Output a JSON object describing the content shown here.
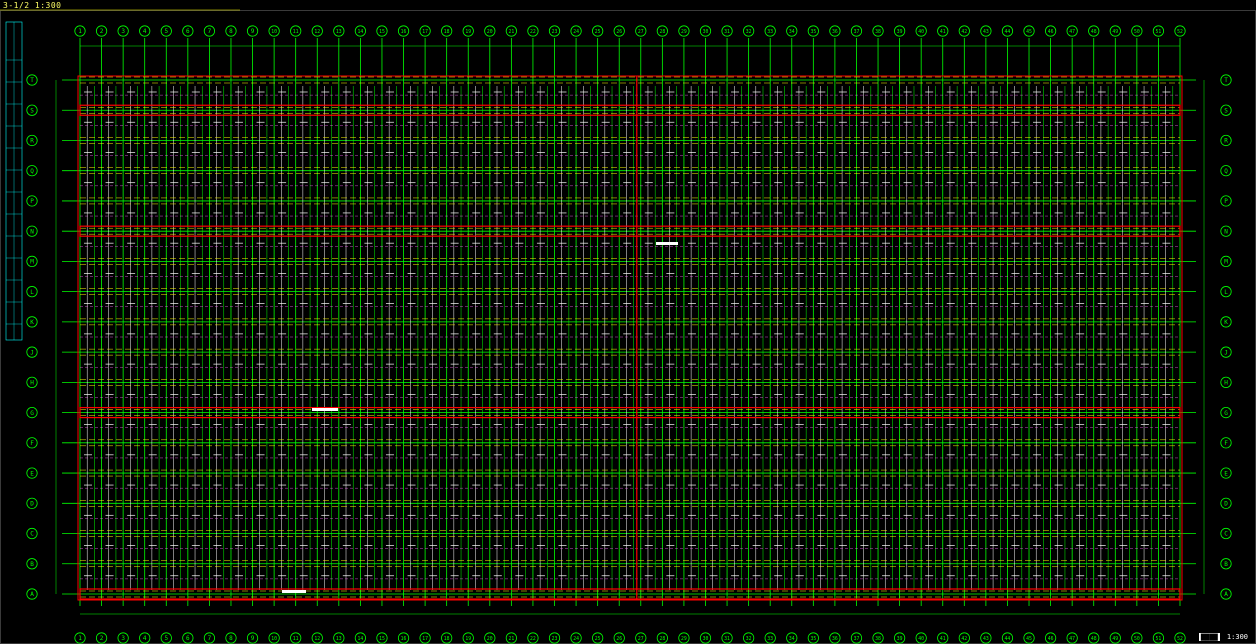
{
  "drawing": {
    "title": "3-1/2 1:300",
    "stamp_label": "▇▇▇▇",
    "stamp_scale": "1:300"
  },
  "grid": {
    "columns": [
      "1",
      "2",
      "3",
      "4",
      "5",
      "6",
      "7",
      "8",
      "9",
      "10",
      "11",
      "12",
      "13",
      "14",
      "15",
      "16",
      "17",
      "18",
      "19",
      "20",
      "21",
      "22",
      "23",
      "24",
      "25",
      "26",
      "27",
      "28",
      "29",
      "30",
      "31",
      "32",
      "33",
      "34",
      "35",
      "36",
      "37",
      "38",
      "39",
      "40",
      "41",
      "42",
      "43",
      "44",
      "45",
      "46",
      "47",
      "48",
      "49",
      "50",
      "51",
      "52"
    ],
    "rows": [
      "T",
      "S",
      "R",
      "Q",
      "P",
      "N",
      "M",
      "L",
      "K",
      "J",
      "H",
      "G",
      "F",
      "E",
      "D",
      "C",
      "B",
      "A"
    ]
  },
  "colors": {
    "background": "#000000",
    "grid_line": "#00ff00",
    "beam_line": "#ff0000",
    "rebar_line": "#ffff00",
    "annotation": "#ffffff",
    "dimension": "#00ffff",
    "detail": "#ff66ff"
  }
}
